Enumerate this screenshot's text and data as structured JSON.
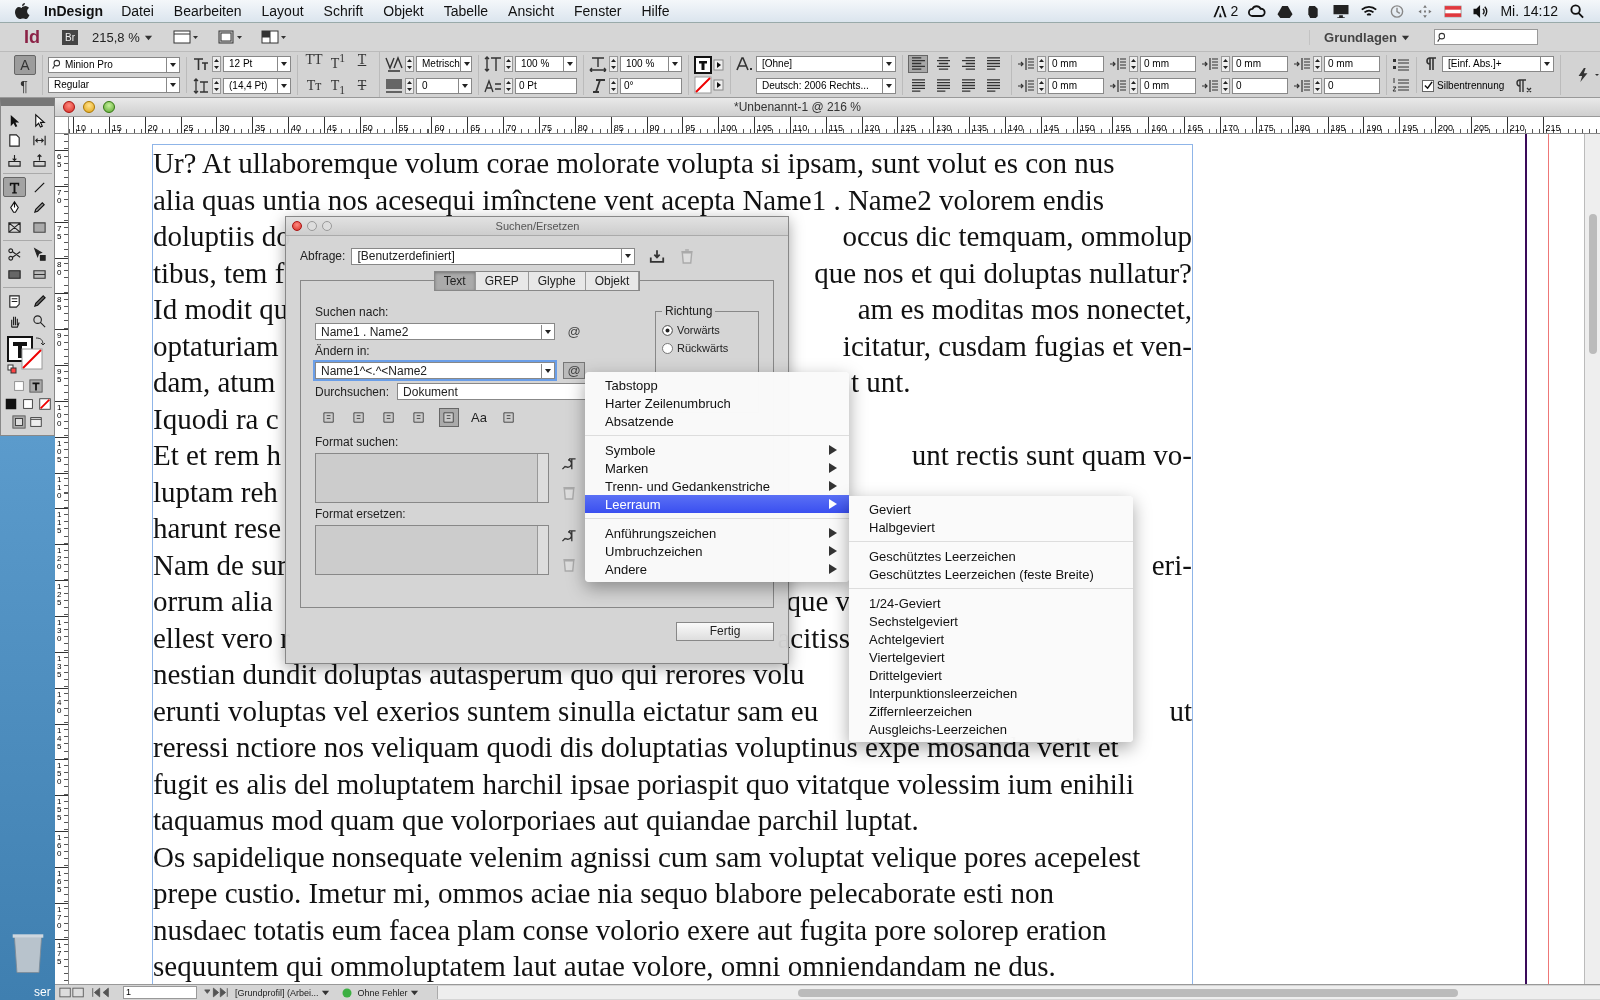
{
  "menubar": {
    "app": "InDesign",
    "menus": [
      "Datei",
      "Bearbeiten",
      "Layout",
      "Schrift",
      "Objekt",
      "Tabelle",
      "Ansicht",
      "Fenster",
      "Hilfe"
    ],
    "badge_count": "2",
    "clock": "Mi. 14:12"
  },
  "app_bar": {
    "logo": "Id",
    "bridge": "Br",
    "zoom": "215,8 %",
    "workspace": "Grundlagen"
  },
  "control_panel": {
    "mode_buttons": [
      {
        "label": "A",
        "selected": true
      },
      {
        "label": "¶",
        "selected": false
      }
    ],
    "font": "Minion Pro",
    "style": "Regular",
    "size": "12 Pt",
    "leading": "(14,4 Pt)",
    "format_buttons": [
      {
        "label": "TT",
        "kind": "plain"
      },
      {
        "label": "T$^{1}$",
        "kind": "plain"
      },
      {
        "label": "T",
        "kind": "underline"
      },
      {
        "label": "Tт",
        "kind": "plain"
      },
      {
        "label": "T$_{1}$",
        "kind": "plain"
      },
      {
        "label": "T",
        "kind": "strike"
      }
    ],
    "kerning": "Metrisch",
    "tracking": "0",
    "vertical_scale": "100 %",
    "baseline_shift": "0 Pt",
    "horizontal_scale": "100 %",
    "skew": "0°",
    "character_style": "[Ohne]",
    "language": "Deutsch: 2006 Rechts...",
    "alignments": [
      {
        "selected": true
      },
      {
        "selected": false
      },
      {
        "selected": false
      },
      {
        "selected": false
      },
      {
        "selected": false
      },
      {
        "selected": false
      },
      {
        "selected": false
      },
      {
        "selected": false
      }
    ],
    "paragraph_fields": [
      "0 mm",
      "0 mm",
      "0 mm",
      "0 mm",
      "0 mm",
      "0 mm",
      "0",
      "0"
    ],
    "paragraph_style": "[Einf. Abs.]+",
    "hyphenation": {
      "label": "Silbentrennung",
      "checked": true
    }
  },
  "tools": [
    {
      "selected": false
    },
    {
      "selected": false
    },
    {
      "selected": false
    },
    {
      "selected": false
    },
    {
      "selected": false
    },
    {
      "selected": false
    },
    {
      "selected": true
    },
    {
      "selected": false
    },
    {
      "selected": false
    },
    {
      "selected": false
    },
    {
      "selected": false
    },
    {
      "selected": false
    },
    {
      "selected": false
    },
    {
      "selected": false
    },
    {
      "selected": false
    },
    {
      "selected": false
    },
    {
      "selected": false
    },
    {
      "selected": false
    },
    {
      "selected": false
    },
    {
      "selected": false
    }
  ],
  "desktop_label": "ser",
  "document": {
    "title": "*Unbenannt-1 @ 216 %",
    "top_ruler": [
      "10",
      "15",
      "20",
      "25",
      "30",
      "35",
      "40",
      "45",
      "50",
      "55",
      "60",
      "65",
      "70",
      "75",
      "80",
      "85",
      "90",
      "95",
      "100",
      "105",
      "110",
      "115",
      "120",
      "125",
      "130",
      "135",
      "140",
      "145",
      "150",
      "155",
      "160",
      "165",
      "170",
      "175",
      "180",
      "185",
      "190",
      "195",
      "200",
      "205",
      "210",
      "215"
    ],
    "left_ruler": [
      "65",
      "70",
      "75",
      "80",
      "85",
      "90",
      "95",
      "100",
      "105",
      "110",
      "115",
      "120",
      "125",
      "130",
      "135",
      "140",
      "145",
      "150",
      "155",
      "160",
      "165",
      "170",
      "175"
    ],
    "lines": [
      {
        "kind": "full",
        "left": "Ur? At ullaboremque volum corae molorate volupta si ipsam, sunt volut es con nus"
      },
      {
        "kind": "full",
        "left": "alia quas untia nos acesequi imînctene vent acepta Name1 . Name2 volorem endis"
      },
      {
        "kind": "end",
        "left": "doluptiis do",
        "right": "occus dic temquam, ommolup"
      },
      {
        "kind": "end",
        "left": "tibus, tem f",
        "right": "que nos et qui doluptas nullatur?"
      },
      {
        "kind": "end",
        "left": "Id modit qu",
        "right": "am es moditas mos nonectet,"
      },
      {
        "kind": "end",
        "left": "optaturiam",
        "right": "icitatur, cusdam fugias et ven-"
      },
      {
        "kind": "after_menu",
        "left": "dam, atum",
        "right": "t unt."
      },
      {
        "kind": "full",
        "left": "Iquodi ra c"
      },
      {
        "kind": "end",
        "left": "Et et rem h",
        "right": "unt rectis sunt quam vo-"
      },
      {
        "kind": "full",
        "left": "luptam reh"
      },
      {
        "kind": "full",
        "left": "harunt rese"
      },
      {
        "kind": "end",
        "left": "Nam de sur",
        "right": "eri-"
      },
      {
        "kind": "before_submenu",
        "left": "orrum alia",
        "right": "que v"
      },
      {
        "kind": "before_submenu",
        "left": "ellest vero r",
        "right": "acitiss"
      },
      {
        "kind": "full",
        "left": "nestian dundit doluptas autasperum quo qui rerores volu"
      },
      {
        "kind": "end",
        "left": "erunti voluptas vel exerios suntem sinulla eictatur sam eu",
        "right": "ut"
      },
      {
        "kind": "full",
        "left": "reressi nctiore nos veliquam quodi dis doluptatias voluptinus expe mosanda verit et"
      },
      {
        "kind": "full",
        "left": "fugit es alis del moluptatem harchil ipsae poriaspit quo vitatque volessim ium enihili"
      },
      {
        "kind": "full",
        "left": "taquamus mod quam que volorporiaes aut quiandae parchil luptat."
      },
      {
        "kind": "full",
        "left": "Os sapidelique nonsequate velenim agnissi cum sam voluptat velique pores acepelest"
      },
      {
        "kind": "full",
        "left": "prepe custio. Imetur mi, ommos aciae nia sequo blabore pelecaborate esti non"
      },
      {
        "kind": "full",
        "left": "nusdaec totatis eum facea plam conse volorio exere aut fugita pore solorep eration"
      },
      {
        "kind": "full",
        "left": "sequuntem qui ommoluptatem laut autae volore, omni omniendandam ne dus."
      }
    ]
  },
  "status_bar": {
    "page": "1",
    "profile": "[Grundprofil] (Arbei...",
    "preflight": "Ohne Fehler"
  },
  "dialog": {
    "title": "Suchen/Ersetzen",
    "query_label": "Abfrage:",
    "query": "[Benutzerdefiniert]",
    "tabs": [
      {
        "label": "Text",
        "selected": true
      },
      {
        "label": "GREP",
        "selected": false
      },
      {
        "label": "Glyphe",
        "selected": false
      },
      {
        "label": "Objekt",
        "selected": false
      }
    ],
    "find_label": "Suchen nach:",
    "find_value": "Name1 . Name2",
    "change_label": "Ändern in:",
    "change_value": "Name1^<.^<Name2",
    "special_char": "@",
    "direction": {
      "title": "Richtung",
      "options": [
        {
          "label": "Vorwärts",
          "selected": true
        },
        {
          "label": "Rückwärts",
          "selected": false
        }
      ]
    },
    "search_label": "Durchsuchen:",
    "search_value": "Dokument",
    "options": [
      {
        "selected": false
      },
      {
        "selected": false
      },
      {
        "selected": false
      },
      {
        "selected": false
      },
      {
        "selected": true
      },
      {
        "selected": false,
        "label": "Aa"
      },
      {
        "selected": false
      }
    ],
    "find_format_label": "Format suchen:",
    "change_format_label": "Format ersetzen:",
    "done": "Fertig"
  },
  "menu": {
    "groups": [
      [
        {
          "label": "Tabstopp",
          "submenu": false,
          "selected": false
        },
        {
          "label": "Harter Zeilenumbruch",
          "submenu": false,
          "selected": false
        },
        {
          "label": "Absatzende",
          "submenu": false,
          "selected": false
        }
      ],
      [
        {
          "label": "Symbole",
          "submenu": true,
          "selected": false
        },
        {
          "label": "Marken",
          "submenu": true,
          "selected": false
        },
        {
          "label": "Trenn- und Gedankenstriche",
          "submenu": true,
          "selected": false
        },
        {
          "label": "Leerraum",
          "submenu": true,
          "selected": true
        }
      ],
      [
        {
          "label": "Anführungszeichen",
          "submenu": true,
          "selected": false
        },
        {
          "label": "Umbruchzeichen",
          "submenu": true,
          "selected": false
        },
        {
          "label": "Andere",
          "submenu": true,
          "selected": false
        }
      ]
    ]
  },
  "submenu": {
    "groups": [
      [
        {
          "label": "Geviert",
          "selected": false
        },
        {
          "label": "Halbgeviert",
          "selected": false
        }
      ],
      [
        {
          "label": "Geschütztes Leerzeichen",
          "selected": false
        },
        {
          "label": "Geschütztes Leerzeichen (feste Breite)",
          "selected": false
        }
      ],
      [
        {
          "label": "1/24-Geviert",
          "selected": false
        },
        {
          "label": "Sechstelgeviert",
          "selected": false
        },
        {
          "label": "Achtelgeviert",
          "selected": false
        },
        {
          "label": "Viertelgeviert",
          "selected": false
        },
        {
          "label": "Drittelgeviert",
          "selected": false
        },
        {
          "label": "Interpunktionsleerzeichen",
          "selected": false
        },
        {
          "label": "Ziffernleerzeichen",
          "selected": false
        },
        {
          "label": "Ausgleichs-Leerzeichen",
          "selected": false
        }
      ]
    ]
  }
}
